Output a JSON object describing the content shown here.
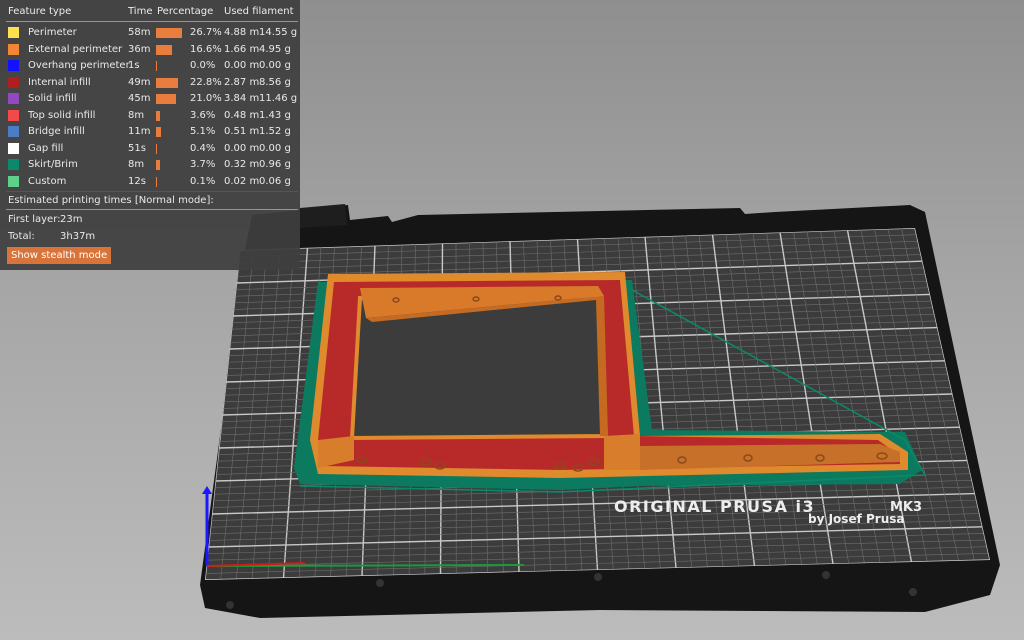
{
  "legend": {
    "headers": {
      "feature": "Feature type",
      "time": "Time",
      "percentage": "Percentage",
      "filament": "Used filament"
    },
    "rows": [
      {
        "name": "Perimeter",
        "color": "#ffe14d",
        "time": "58m",
        "pct": 26.7,
        "pct_label": "26.7%",
        "meters": "4.88 m",
        "grams": "14.55 g"
      },
      {
        "name": "External perimeter",
        "color": "#f28637",
        "time": "36m",
        "pct": 16.6,
        "pct_label": "16.6%",
        "meters": "1.66 m",
        "grams": "4.95 g"
      },
      {
        "name": "Overhang perimeter",
        "color": "#1212ff",
        "time": "1s",
        "pct": 0.0,
        "pct_label": "0.0%",
        "meters": "0.00 m",
        "grams": "0.00 g"
      },
      {
        "name": "Internal infill",
        "color": "#b01f1f",
        "time": "49m",
        "pct": 22.8,
        "pct_label": "22.8%",
        "meters": "2.87 m",
        "grams": "8.56 g"
      },
      {
        "name": "Solid infill",
        "color": "#9248c0",
        "time": "45m",
        "pct": 21.0,
        "pct_label": "21.0%",
        "meters": "3.84 m",
        "grams": "11.46 g"
      },
      {
        "name": "Top solid infill",
        "color": "#f24a4a",
        "time": "8m",
        "pct": 3.6,
        "pct_label": "3.6%",
        "meters": "0.48 m",
        "grams": "1.43 g"
      },
      {
        "name": "Bridge infill",
        "color": "#4c7cc4",
        "time": "11m",
        "pct": 5.1,
        "pct_label": "5.1%",
        "meters": "0.51 m",
        "grams": "1.52 g"
      },
      {
        "name": "Gap fill",
        "color": "#ffffff",
        "time": "51s",
        "pct": 0.4,
        "pct_label": "0.4%",
        "meters": "0.00 m",
        "grams": "0.00 g"
      },
      {
        "name": "Skirt/Brim",
        "color": "#0a8a6a",
        "time": "8m",
        "pct": 3.7,
        "pct_label": "3.7%",
        "meters": "0.32 m",
        "grams": "0.96 g"
      },
      {
        "name": "Custom",
        "color": "#5ed08c",
        "time": "12s",
        "pct": 0.1,
        "pct_label": "0.1%",
        "meters": "0.02 m",
        "grams": "0.06 g"
      }
    ]
  },
  "estimates": {
    "title": "Estimated printing times [Normal mode]:",
    "first_layer_label": "First layer:",
    "first_layer_value": "23m",
    "total_label": "Total:",
    "total_value": "3h37m",
    "stealth_button": "Show stealth mode"
  },
  "bed": {
    "brand_line1": "ORIGINAL PRUSA i3",
    "brand_model": "MK3",
    "brand_line2": "by Josef Prusa"
  },
  "colors": {
    "accent": "#e87d3e",
    "infill": "#b82a2a",
    "perimeter": "#e08a2e",
    "brim": "#0c7a5e"
  }
}
